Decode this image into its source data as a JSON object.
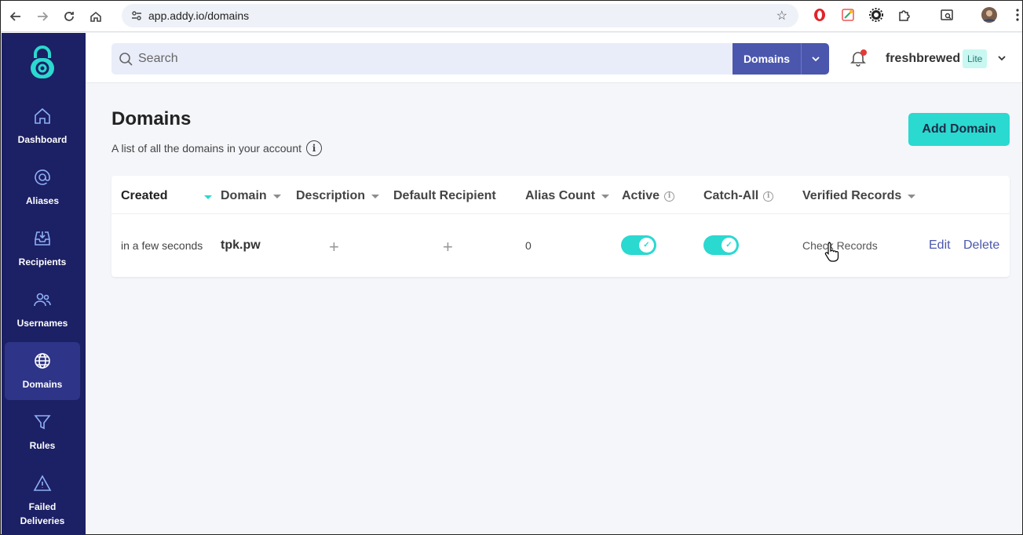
{
  "browser": {
    "url": "app.addy.io/domains"
  },
  "sidebar": {
    "items": [
      {
        "label": "Dashboard",
        "icon": "home-icon"
      },
      {
        "label": "Aliases",
        "icon": "at-icon"
      },
      {
        "label": "Recipients",
        "icon": "inbox-icon"
      },
      {
        "label": "Usernames",
        "icon": "users-icon"
      },
      {
        "label": "Domains",
        "icon": "globe-icon",
        "active": true
      },
      {
        "label": "Rules",
        "icon": "funnel-icon"
      },
      {
        "label": "Failed Deliveries",
        "icon": "warning-icon"
      }
    ]
  },
  "topbar": {
    "search_placeholder": "Search",
    "search_scope": "Domains",
    "username": "freshbrewed",
    "plan": "Lite"
  },
  "main": {
    "title": "Domains",
    "subtitle": "A list of all the domains in your account",
    "add_button": "Add Domain"
  },
  "table": {
    "headers": {
      "created": "Created",
      "domain": "Domain",
      "description": "Description",
      "default_recipient": "Default Recipient",
      "alias_count": "Alias Count",
      "active": "Active",
      "catch_all": "Catch-All",
      "verified_records": "Verified Records"
    },
    "rows": [
      {
        "created": "in a few seconds",
        "domain": "tpk.pw",
        "alias_count": "0",
        "active": true,
        "catch_all": true,
        "verified_records": "Check Records",
        "edit": "Edit",
        "delete": "Delete"
      }
    ]
  },
  "colors": {
    "sidebar_bg": "#1c2064",
    "accent_teal": "#2ad9d0",
    "primary_indigo": "#4b57ad"
  }
}
